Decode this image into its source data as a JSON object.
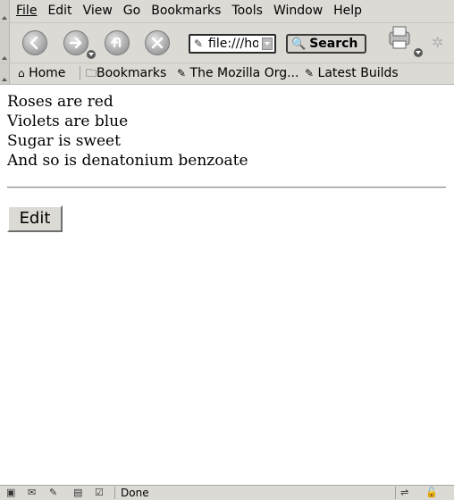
{
  "menubar": {
    "items": [
      "File",
      "Edit",
      "View",
      "Go",
      "Bookmarks",
      "Tools",
      "Window",
      "Help"
    ]
  },
  "navbar": {
    "url_value": "file:///ho",
    "search_label": "Search"
  },
  "bookmarks": {
    "home": "Home",
    "bookmarks": "Bookmarks",
    "mozilla": "The Mozilla Org...",
    "latest": "Latest Builds"
  },
  "content": {
    "lines": [
      "Roses are red",
      "Violets are blue",
      "Sugar is sweet",
      "And so is denatonium benzoate"
    ],
    "edit_label": "Edit"
  },
  "statusbar": {
    "text": "Done"
  }
}
